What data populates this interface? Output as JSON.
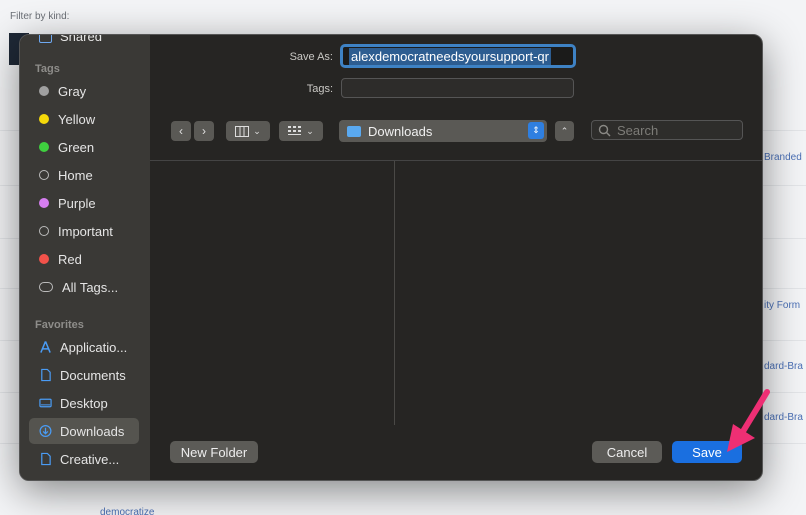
{
  "background": {
    "filter_label": "Filter by kind:",
    "links": [
      "Branded",
      "ity Form",
      "dard-Bra",
      "dard-Bra",
      "democratize",
      "Shared"
    ]
  },
  "dialog": {
    "save_as_label": "Save As:",
    "filename": "alexdemocratneedsyoursupport-qr",
    "tags_label": "Tags:",
    "tags_value": "",
    "location": "Downloads",
    "search_placeholder": "Search",
    "new_folder_label": "New Folder",
    "cancel_label": "Cancel",
    "save_label": "Save"
  },
  "sidebar": {
    "tags_section": "Tags",
    "tags": [
      {
        "label": "Gray",
        "color": "#a0a0a0"
      },
      {
        "label": "Yellow",
        "color": "#f5d90a"
      },
      {
        "label": "Green",
        "color": "#3fd03f"
      },
      {
        "label": "Home",
        "color": ""
      },
      {
        "label": "Purple",
        "color": "#d67ef0"
      },
      {
        "label": "Important",
        "color": ""
      },
      {
        "label": "Red",
        "color": "#f2524a"
      },
      {
        "label": "All Tags..."
      }
    ],
    "favorites_section": "Favorites",
    "favorites": [
      {
        "label": "Applicatio...",
        "icon": "applications-icon"
      },
      {
        "label": "Documents",
        "icon": "document-icon"
      },
      {
        "label": "Desktop",
        "icon": "desktop-icon"
      },
      {
        "label": "Downloads",
        "icon": "downloads-icon",
        "selected": true
      },
      {
        "label": "Creative...",
        "icon": "document-icon"
      }
    ]
  },
  "colors": {
    "accent": "#1a6fe0",
    "annotation_arrow": "#ee2f74"
  }
}
